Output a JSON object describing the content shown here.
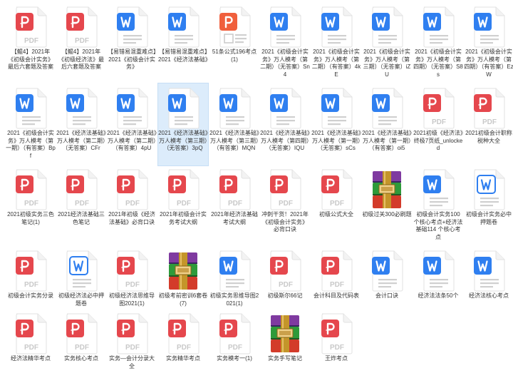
{
  "colors": {
    "pdf": "#e5474d",
    "word": "#2f7ff0",
    "ppt": "#f05f3c",
    "rar_purple": "#7f3aa0",
    "rar_green": "#2e9a3a",
    "rar_red": "#d33b2a",
    "rar_gold": "#c4952a",
    "selection": "#dcecfb"
  },
  "files": [
    {
      "type": "pdf",
      "label": "【鲲4】2021年《初级会计实务》最后六套题及答案"
    },
    {
      "type": "pdf",
      "label": "【鲲4】2021年《初级经济法》最后六套题及答案"
    },
    {
      "type": "word",
      "label": "【易错易混重难点】2021《初级会计实务》"
    },
    {
      "type": "word",
      "label": "【易错易混重难点】2021《经济法基础》"
    },
    {
      "type": "ppt",
      "label": "51条公式196考点(1)"
    },
    {
      "type": "word",
      "label": "2021《初级会计实务》万人模考（第二期）（无答案）Sn4"
    },
    {
      "type": "word",
      "label": "2021《初级会计实务》万人模考（第二期）（有答案）4kE"
    },
    {
      "type": "word",
      "label": "2021《初级会计实务》万人模考（第三期）（无答案）iZU"
    },
    {
      "type": "word",
      "label": "2021《初级会计实务》万人模考（第四期）（无答案）S8s"
    },
    {
      "type": "word",
      "label": "2021《初级会计实务》万人模考（第四期）（有答案）EzW"
    },
    {
      "type": "word",
      "label": "2021《初级会计实务》万人模考（第一期）（有答案）Bpf"
    },
    {
      "type": "word",
      "label": "2021《经济法基础》万人模考（第二期）（无答案）CFr"
    },
    {
      "type": "word",
      "label": "2021《经济法基础》万人模考（第二期）（有答案）4pU"
    },
    {
      "type": "word",
      "label": "2021《经济法基础》万人模考（第三期）（无答案）3pQ",
      "selected": true
    },
    {
      "type": "word",
      "label": "2021《经济法基础》万人模考（第三期）（有答案）MQN"
    },
    {
      "type": "word",
      "label": "2021《经济法基础》万人模考（第四期）（无答案）IQU"
    },
    {
      "type": "word",
      "label": "2021《经济法基础》万人模考（第一期）（无答案）sCs"
    },
    {
      "type": "word",
      "label": "2021《经济法基础》万人模考（第一期）（有答案）oi5"
    },
    {
      "type": "pdf",
      "label": "2021初级《经济法》终极7页纸_unlocked"
    },
    {
      "type": "pdf",
      "label": "2021初级会计职称税种大全"
    },
    {
      "type": "pdf",
      "label": "2021初级实务三色笔记(1)"
    },
    {
      "type": "pdf",
      "label": "2021经济法基础三色笔记"
    },
    {
      "type": "pdf",
      "label": "2021年初级《经济法基础》必背口诀"
    },
    {
      "type": "pdf",
      "label": "2021年初级会计实务考试大纲"
    },
    {
      "type": "pdf",
      "label": "2021年经济法基础考试大纲"
    },
    {
      "type": "pdf",
      "label": "冲刺干货！2021年《初级会计实务》必背口诀"
    },
    {
      "type": "pdf",
      "label": "初级公式大全"
    },
    {
      "type": "rar",
      "label": "初级过关300必刷题"
    },
    {
      "type": "word",
      "label": "初级会计实务100 个核心考点+经济法基础114 个核心考点"
    },
    {
      "type": "word2",
      "label": "初级会计实务必中押题卷"
    },
    {
      "type": "pdf",
      "label": "初级会计实务分录"
    },
    {
      "type": "word2",
      "label": "初级经济法必中押题卷"
    },
    {
      "type": "pdf",
      "label": "初级经济法思维导图2021(1)"
    },
    {
      "type": "rar",
      "label": "初级考前密训6套卷(7)"
    },
    {
      "type": "word",
      "label": "初级实务思维导图2021(1)"
    },
    {
      "type": "pdf",
      "label": "初级斯尔66记"
    },
    {
      "type": "pdf",
      "label": "会计科目及代码表"
    },
    {
      "type": "word",
      "label": "会计口诀"
    },
    {
      "type": "word",
      "label": "经济法法条50个"
    },
    {
      "type": "word",
      "label": "经济法核心考点"
    },
    {
      "type": "pdf",
      "label": "经济法精华考点"
    },
    {
      "type": "pdf",
      "label": "实务核心考点"
    },
    {
      "type": "pdf",
      "label": "实务—会计分录大全"
    },
    {
      "type": "pdf",
      "label": "实务精华考点"
    },
    {
      "type": "pdf",
      "label": "实务模考一(1)"
    },
    {
      "type": "rar",
      "label": "实务手写笔记"
    },
    {
      "type": "pdf",
      "label": "王炸考点"
    }
  ]
}
